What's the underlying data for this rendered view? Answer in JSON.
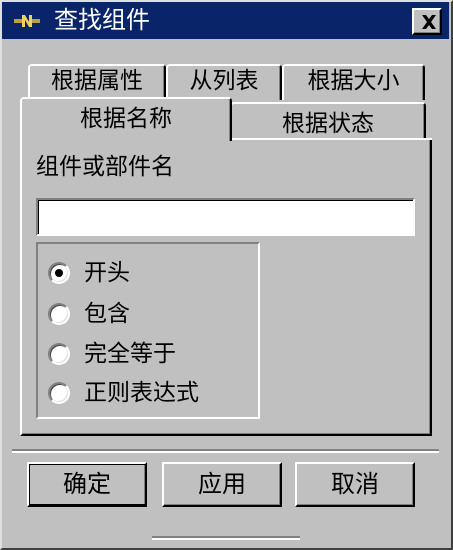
{
  "window": {
    "title": "查找组件",
    "title_icon": "nx-app-icon",
    "close_label": "close"
  },
  "tabs": {
    "row_back": [
      "根据属性",
      "从列表",
      "根据大小"
    ],
    "row_front": [
      "根据名称",
      "根据状态"
    ],
    "active": "根据名称"
  },
  "panel": {
    "field_label": "组件或部件名",
    "input_value": "",
    "input_placeholder": "",
    "match_options": [
      {
        "label": "开头",
        "selected": true
      },
      {
        "label": "包含",
        "selected": false
      },
      {
        "label": "完全等于",
        "selected": false
      },
      {
        "label": "正则表达式",
        "selected": false
      }
    ]
  },
  "buttons": {
    "ok": "确定",
    "apply": "应用",
    "cancel": "取消"
  },
  "colors": {
    "title_bar": "#0a246a",
    "face": "#c0c0c0"
  }
}
